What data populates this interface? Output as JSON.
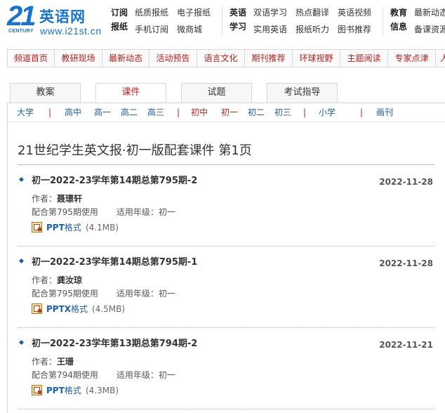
{
  "logo": {
    "number": "21",
    "century": "CENTURY",
    "name": "英语网",
    "url": "www.i21st.cn"
  },
  "header_groups": [
    {
      "title_line1": "订阅",
      "title_line2": "报纸",
      "row1": [
        "纸质报纸",
        "电子报纸"
      ],
      "row2": [
        "手机订阅",
        "微商城"
      ]
    },
    {
      "title_line1": "英语",
      "title_line2": "学习",
      "row1": [
        "双语学习",
        "热点翻译",
        "英语视频"
      ],
      "row2": [
        "实用英语",
        "报纸听力",
        "图书推荐"
      ]
    },
    {
      "title_line1": "教育",
      "title_line2": "信息",
      "row1": [
        "最新动态"
      ],
      "row2": [
        "备课资源"
      ]
    }
  ],
  "channel_nav": [
    "频道首页",
    "教研现场",
    "最新动态",
    "活动预告",
    "语言文化",
    "期刊推荐",
    "环球视野",
    "主题阅读",
    "专家点津",
    "人"
  ],
  "tabs": [
    {
      "label": "教案",
      "active": false
    },
    {
      "label": "课件",
      "active": true
    },
    {
      "label": "试题",
      "active": false
    },
    {
      "label": "考试指导",
      "active": false
    }
  ],
  "grade_nav": {
    "daxue": "大学",
    "gaozhong": "高中",
    "gaoyi": "高一",
    "gaoer": "高二",
    "gaosan": "高三",
    "chuzhong": "初中",
    "chuyi": "初一",
    "chuer": "初二",
    "chusan": "初三",
    "xiaoxue": "小学",
    "huakan": "画刊",
    "separator": "|"
  },
  "page_title": "21世纪学生英文报·初一版配套课件 第1页",
  "labels": {
    "author": "作者：",
    "grade_prefix": "适用年级："
  },
  "entries": [
    {
      "title": "初一2022-23学年第14期总第795期-2",
      "date": "2022-11-28",
      "author": "聂璟轩",
      "usage": "配合第795期使用",
      "grade": "初一",
      "format_code": "PPT",
      "format_suffix": "格式",
      "size": "(4.1MB)"
    },
    {
      "title": "初一2022-23学年第14期总第795期-1",
      "date": "2022-11-28",
      "author": "龚汝琼",
      "usage": "配合第795期使用",
      "grade": "初一",
      "format_code": "PPTX",
      "format_suffix": "格式",
      "size": "(4.5MB)"
    },
    {
      "title": "初一2022-23学年第13期总第794期-2",
      "date": "2022-11-21",
      "author": "王珊",
      "usage": "配合第794期使用",
      "grade": "初一",
      "format_code": "PPT",
      "format_suffix": "格式",
      "size": "(4.3MB)"
    }
  ],
  "colors": {
    "brand_blue": "#1a73c8",
    "link_blue": "#1f5fa6",
    "accent_red": "#c8201e"
  }
}
